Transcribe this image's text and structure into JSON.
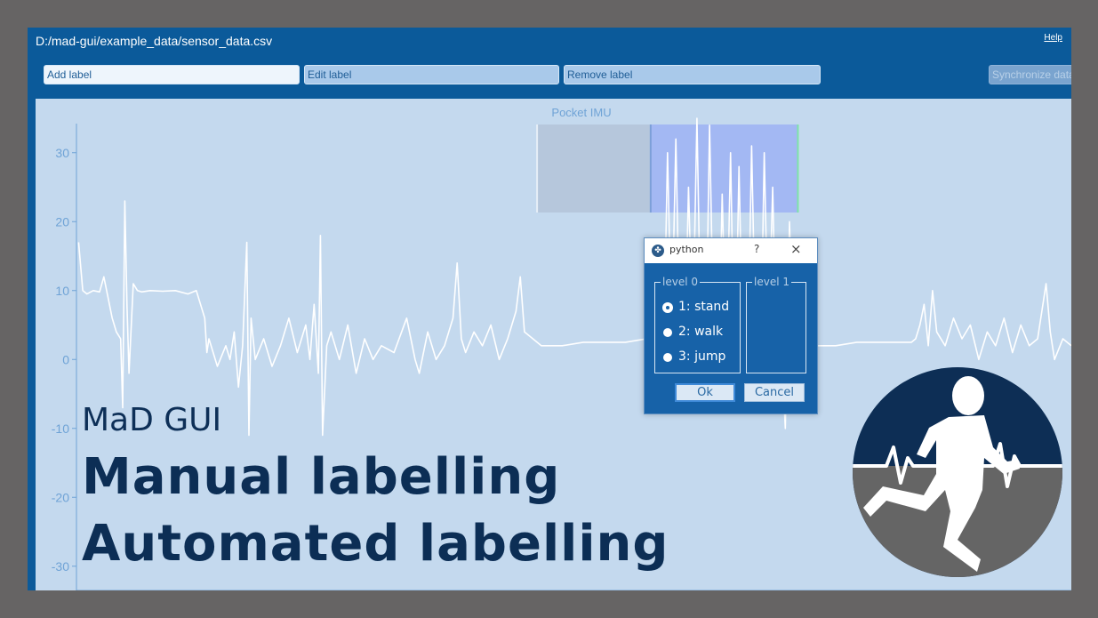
{
  "window": {
    "file_path": "D:/mad-gui/example_data/sensor_data.csv",
    "help_label": "Help"
  },
  "toolbar": {
    "add_label": "Add label",
    "edit_label": "Edit label",
    "remove_label": "Remove label",
    "synchronize_label": "Synchronize data"
  },
  "dialog": {
    "title": "python",
    "help_glyph": "?",
    "close_glyph": "×",
    "level0_title": "level 0",
    "level1_title": "level 1",
    "options": [
      {
        "label": "1: stand",
        "selected": true
      },
      {
        "label": "2: walk",
        "selected": false
      },
      {
        "label": "3: jump",
        "selected": false
      }
    ],
    "ok_label": "Ok",
    "cancel_label": "Cancel"
  },
  "overlay": {
    "brand": "MaD GUI",
    "headline_1": "Manual labelling",
    "headline_2": "Automated labelling"
  },
  "colors": {
    "accent": "#0b5a9a",
    "headline": "#0c2e55",
    "plot_bg": "#c4d9ee",
    "signal": "#ffffff",
    "axis": "#6fa3d6",
    "label_region": "#a3b8f3"
  },
  "chart_data": {
    "type": "line",
    "title": "Pocket IMU",
    "xlabel": "",
    "ylabel": "",
    "xlim": [
      3.95,
      27.6
    ],
    "ylim": [
      -33,
      35
    ],
    "xticks": [
      4,
      6,
      8,
      10,
      12,
      14,
      16,
      18,
      20,
      22,
      24,
      26
    ],
    "yticks": [
      -30,
      -20,
      -10,
      0,
      10,
      20,
      30
    ],
    "label_regions": [
      {
        "x_start": 14.9,
        "x_end": 17.6,
        "shade": "grey"
      },
      {
        "x_start": 17.6,
        "x_end": 21.1,
        "shade": "blue"
      }
    ],
    "series": [
      {
        "x": [
          4.0,
          4.1,
          4.2,
          4.35,
          4.5,
          4.6,
          4.7,
          4.8,
          4.9,
          5.0,
          5.05,
          5.1,
          5.15,
          5.2,
          5.3,
          5.4,
          5.5,
          5.7,
          6.0,
          6.3,
          6.6,
          6.8,
          7.0,
          7.05,
          7.1,
          7.3,
          7.5,
          7.6,
          7.7,
          7.8,
          7.9,
          8.0,
          8.05,
          8.1,
          8.2,
          8.4,
          8.6,
          8.8,
          9.0,
          9.2,
          9.4,
          9.5,
          9.6,
          9.7,
          9.75,
          9.8,
          9.9,
          10.0,
          10.2,
          10.4,
          10.6,
          10.8,
          11.0,
          11.2,
          11.5,
          11.8,
          12.0,
          12.1,
          12.3,
          12.5,
          12.7,
          12.9,
          13.0,
          13.1,
          13.2,
          13.4,
          13.6,
          13.8,
          14.0,
          14.2,
          14.4,
          14.5,
          14.6,
          14.8,
          15.0,
          15.5,
          16.0,
          16.5,
          17.0,
          17.5,
          17.7,
          17.9,
          18.0,
          18.1,
          18.2,
          18.3,
          18.4,
          18.5,
          18.6,
          18.7,
          18.8,
          18.9,
          19.0,
          19.1,
          19.2,
          19.3,
          19.4,
          19.5,
          19.6,
          19.7,
          19.8,
          19.9,
          20.0,
          20.1,
          20.2,
          20.3,
          20.4,
          20.5,
          20.6,
          20.7,
          20.8,
          20.9,
          21.0,
          21.2,
          21.5,
          22.0,
          22.5,
          23.0,
          23.5,
          23.8,
          23.9,
          24.0,
          24.1,
          24.2,
          24.3,
          24.4,
          24.6,
          24.8,
          25.0,
          25.2,
          25.4,
          25.6,
          25.8,
          26.0,
          26.2,
          26.4,
          26.6,
          26.8,
          27.0,
          27.1,
          27.2,
          27.4,
          27.6
        ],
        "y": [
          17,
          10,
          9.5,
          10,
          9.8,
          12,
          9,
          6,
          4,
          3,
          -7,
          23,
          8,
          -2,
          11,
          10,
          9.8,
          10,
          9.9,
          10,
          9.5,
          10,
          6,
          1,
          3,
          -1,
          2,
          0,
          4,
          -4,
          2,
          17,
          -11,
          6,
          0,
          3,
          -1,
          2,
          6,
          1,
          5,
          0,
          8,
          -2,
          18,
          -11,
          2,
          4,
          0,
          5,
          -2,
          3,
          0,
          2,
          1,
          6,
          0,
          -2,
          4,
          0,
          2,
          6,
          14,
          3,
          1,
          4,
          2,
          5,
          0,
          3,
          7,
          12,
          4,
          3,
          2,
          2,
          2.5,
          2.5,
          2.5,
          3,
          5,
          -3,
          30,
          3,
          32,
          0,
          -3,
          25,
          3,
          35,
          1,
          -4,
          34,
          2,
          -6,
          24,
          0,
          30,
          -5,
          28,
          -2,
          -3,
          31,
          1,
          -6,
          30,
          2,
          25,
          -3,
          3,
          -10,
          20,
          2,
          3,
          2,
          2,
          2.5,
          2.5,
          2.5,
          2.5,
          3,
          5,
          8,
          2,
          10,
          4,
          2,
          6,
          3,
          5,
          0,
          4,
          2,
          6,
          1,
          5,
          2,
          3,
          11,
          4,
          0,
          3,
          2
        ]
      }
    ]
  }
}
